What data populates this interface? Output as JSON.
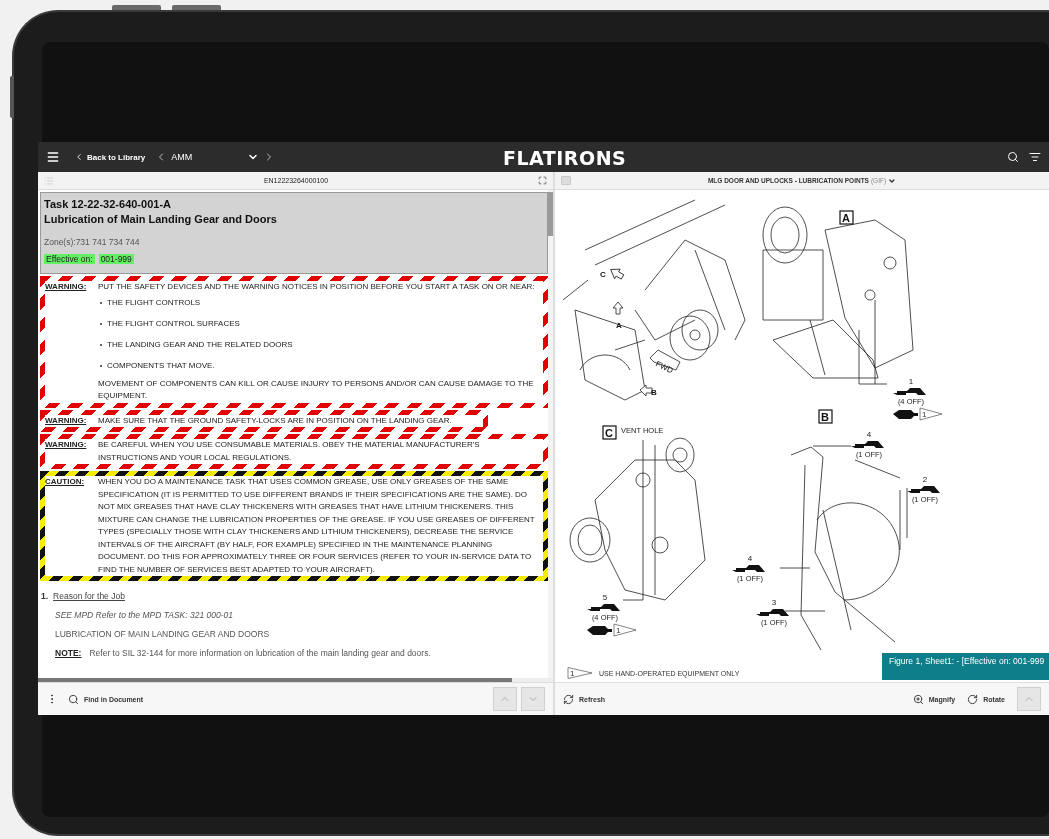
{
  "header": {
    "back": "Back to Library",
    "book": "AMM",
    "logo": "FLATIRONS"
  },
  "document": {
    "id": "EN12223264000100",
    "task": "Task 12-22-32-640-001-A",
    "title": "Lubrication of Main Landing Gear and Doors",
    "zones": "Zone(s):731 741 734 744",
    "effective_label": "Effective on:",
    "effective_value": "001-999",
    "notices": [
      {
        "kind": "warning",
        "label": "WARNING:",
        "text": "PUT THE SAFETY DEVICES AND THE WARNING NOTICES IN POSITION BEFORE YOU START A TASK ON OR NEAR:",
        "bullets": [
          "THE FLIGHT CONTROLS",
          "THE FLIGHT CONTROL SURFACES",
          "THE LANDING GEAR AND THE RELATED DOORS",
          "COMPONENTS THAT MOVE."
        ],
        "after": "MOVEMENT OF COMPONENTS CAN KILL OR CAUSE INJURY TO PERSONS AND/OR CAN CAUSE DAMAGE TO THE EQUIPMENT."
      },
      {
        "kind": "warning",
        "label": "WARNING:",
        "text": "MAKE SURE THAT THE GROUND SAFETY-LOCKS ARE IN POSITION ON THE LANDING GEAR."
      },
      {
        "kind": "warning",
        "label": "WARNING:",
        "text": "BE CAREFUL WHEN YOU USE CONSUMABLE MATERIALS. OBEY THE MATERIAL MANUFACTURER'S INSTRUCTIONS AND YOUR LOCAL REGULATIONS."
      },
      {
        "kind": "caution",
        "label": "CAUTION:",
        "text": "WHEN YOU DO A MAINTENANCE TASK THAT USES COMMON GREASE, USE ONLY GREASES OF THE SAME SPECIFICATION (IT IS PERMITTED TO USE DIFFERENT BRANDS IF THEIR SPECIFICATIONS ARE THE SAME). DO NOT MIX GREASES THAT HAVE CLAY THICKENERS WITH GREASES THAT HAVE LITHIUM THICKENERS. THIS MIXTURE CAN CHANGE THE LUBRICATION PROPERTIES OF THE GREASE. IF YOU USE GREASES OF DIFFERENT TYPES (SPECIALLY THOSE WITH CLAY THICKENERS AND LITHIUM THICKENERS), DECREASE THE SERVICE INTERVALS OF THE AIRCRAFT (BY HALF, FOR EXAMPLE) SPECIFIED IN THE MAINTENANCE PLANNING DOCUMENT. DO THIS FOR APPROXIMATELY THREE OR FOUR SERVICES (REFER TO YOUR IN-SERVICE DATA TO FIND THE NUMBER OF SERVICES BEST ADAPTED TO YOUR AIRCRAFT)."
      }
    ],
    "sections": [
      {
        "number": "1.",
        "title": "Reason for the Job",
        "lines": [
          {
            "kind": "ref",
            "text": "SEE MPD Refer to the MPD TASK: 321 000-01"
          },
          {
            "kind": "plain",
            "text": "LUBRICATION OF MAIN LANDING GEAR AND DOORS"
          },
          {
            "kind": "note",
            "label": "NOTE:",
            "text": "Refer to SIL 32-144 for more information on lubrication of the main landing gear and doors."
          }
        ]
      }
    ]
  },
  "find": {
    "label": "Find in Document"
  },
  "figure": {
    "title": "MLG DOOR AND UPLOCKS - LUBRICATION POINTS",
    "format": "(GIF)",
    "overview_labels": [
      "C",
      "A",
      "B"
    ],
    "fwd": "FWD",
    "views": [
      "A",
      "B",
      "C"
    ],
    "vent": "VENT HOLE",
    "callouts": [
      {
        "number": "1",
        "quantity": "(4 OFF)",
        "note": "1"
      },
      {
        "number": "4",
        "quantity": "(1 OFF)"
      },
      {
        "number": "2",
        "quantity": "(1 OFF)"
      },
      {
        "number": "4",
        "quantity": "(1 OFF)"
      },
      {
        "number": "5",
        "quantity": "(4 OFF)",
        "note": "1"
      },
      {
        "number": "3",
        "quantity": "(1 OFF)"
      }
    ],
    "legend_mark": "1",
    "legend": "USE HAND-OPERATED EQUIPMENT ONLY",
    "caption": "Figure 1, Sheet1: - [Effective on: 001-999"
  },
  "figure_toolbar": {
    "refresh": "Refresh",
    "magnify": "Magnify",
    "rotate": "Rotate"
  }
}
